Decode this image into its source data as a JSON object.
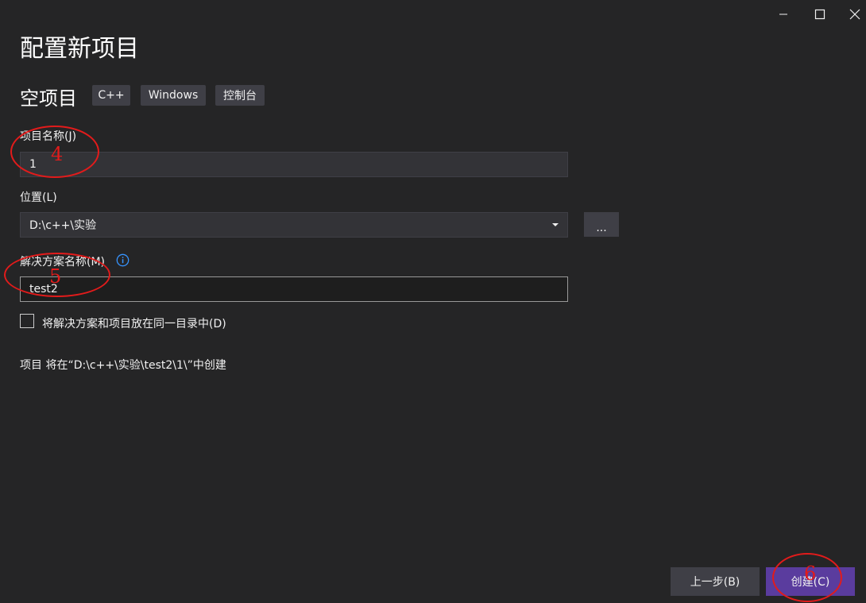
{
  "window": {
    "minimize_icon": "minimize-icon",
    "maximize_icon": "maximize-icon",
    "close_icon": "close-icon"
  },
  "header": {
    "title": "配置新项目",
    "template_name": "空项目",
    "tags": [
      "C++",
      "Windows",
      "控制台"
    ]
  },
  "project_name": {
    "label": "项目名称(J)",
    "value": "1"
  },
  "location": {
    "label": "位置(L)",
    "value": "D:\\c++\\实验",
    "browse_label": "..."
  },
  "solution_name": {
    "label": "解决方案名称(M)",
    "value": "test2"
  },
  "same_dir_checkbox": {
    "label": "将解决方案和项目放在同一目录中(D)",
    "checked": false
  },
  "summary": "项目 将在“D:\\c++\\实验\\test2\\1\\”中创建",
  "footer": {
    "back_label": "上一步(B)",
    "create_label": "创建(C)"
  },
  "annotations": [
    "4",
    "5",
    "6"
  ],
  "colors": {
    "background": "#252526",
    "accent": "#5a3c9e",
    "annotation": "#e21b1b"
  }
}
